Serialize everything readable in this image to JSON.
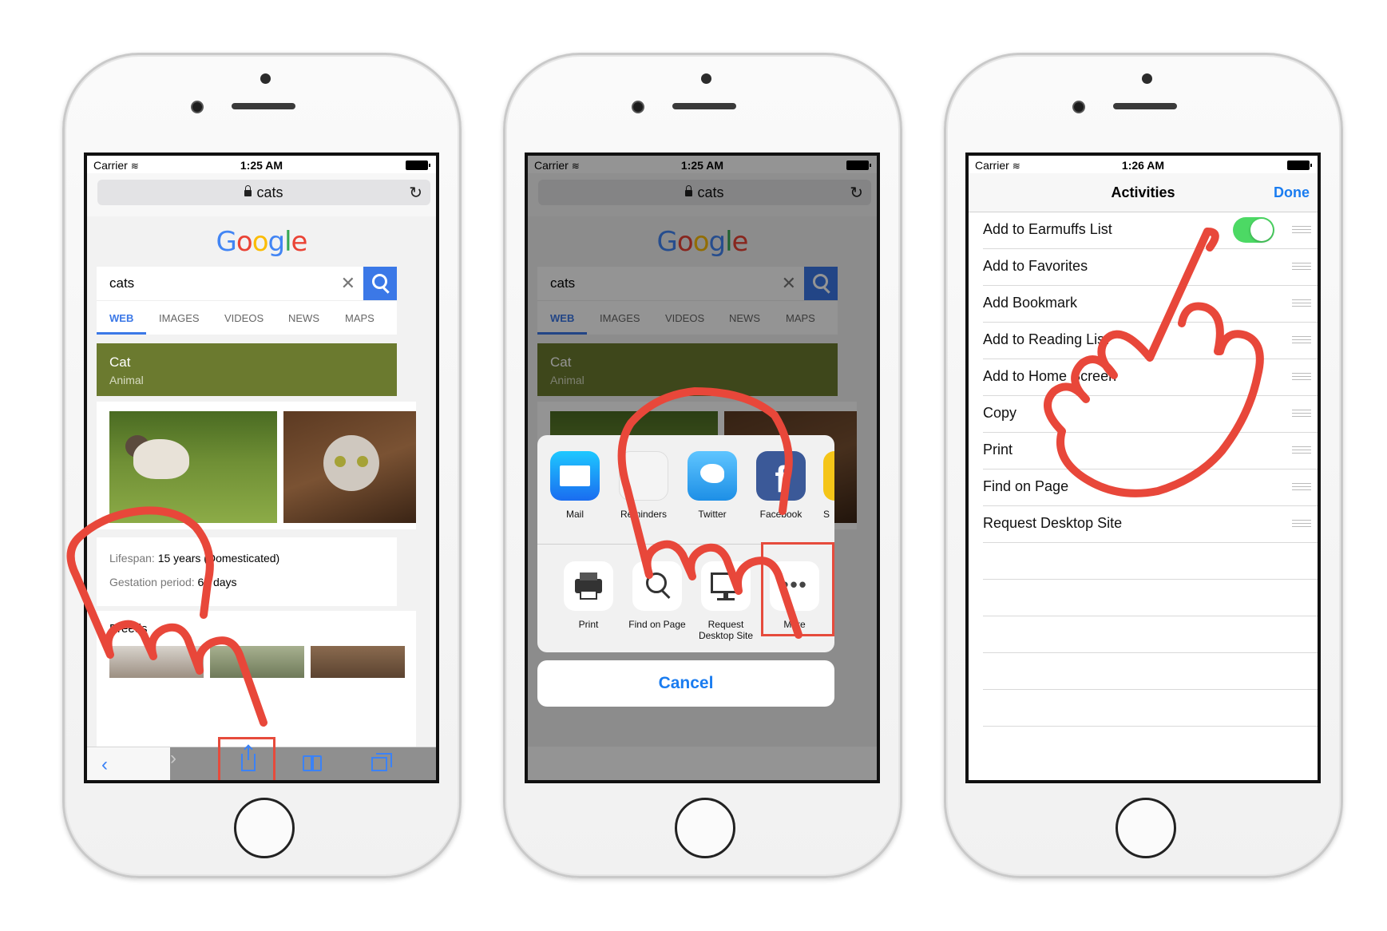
{
  "status": {
    "carrier": "Carrier",
    "time1": "1:25 AM",
    "time2": "1:25 AM",
    "time3": "1:26 AM"
  },
  "safari": {
    "url": "cats"
  },
  "google": {
    "logo": [
      {
        "ch": "G",
        "color": "#4285f4"
      },
      {
        "ch": "o",
        "color": "#ea4335"
      },
      {
        "ch": "o",
        "color": "#fbbc05"
      },
      {
        "ch": "g",
        "color": "#4285f4"
      },
      {
        "ch": "l",
        "color": "#34a853"
      },
      {
        "ch": "e",
        "color": "#ea4335"
      }
    ],
    "query": "cats",
    "tabs": [
      "WEB",
      "IMAGES",
      "VIDEOS",
      "NEWS",
      "MAPS"
    ],
    "card_title": "Cat",
    "card_subtitle": "Animal",
    "lifespan_label": "Lifespan:",
    "lifespan_value": "15 years (Domesticated)",
    "gestation_label": "Gestation period:",
    "gestation_value": "66 days",
    "breeds_heading": "Breeds"
  },
  "share_sheet": {
    "apps": [
      {
        "label": "Mail",
        "icon": "mail-icon",
        "color": "#1e8cf5"
      },
      {
        "label": "Reminders",
        "icon": "reminders-icon",
        "color": "#f4f4f4"
      },
      {
        "label": "Twitter",
        "icon": "twitter-icon",
        "color": "#1da1f2"
      },
      {
        "label": "Facebook",
        "icon": "facebook-icon",
        "color": "#3b5998"
      },
      {
        "label": "S",
        "icon": "partial-app-icon",
        "color": "#f5c518"
      }
    ],
    "actions": [
      {
        "label": "Print",
        "icon": "printer-icon"
      },
      {
        "label": "Find on Page",
        "icon": "magnifier-icon"
      },
      {
        "label": "Request Desktop Site",
        "icon": "monitor-icon"
      },
      {
        "label": "More",
        "icon": "more-dots-icon"
      }
    ],
    "cancel": "Cancel"
  },
  "activities": {
    "title": "Activities",
    "done": "Done",
    "items": [
      {
        "label": "Add to Earmuffs List",
        "toggle_on": true
      },
      {
        "label": "Add to Favorites"
      },
      {
        "label": "Add Bookmark"
      },
      {
        "label": "Add to Reading List"
      },
      {
        "label": "Add to Home Screen"
      },
      {
        "label": "Copy"
      },
      {
        "label": "Print"
      },
      {
        "label": "Find on Page"
      },
      {
        "label": "Request Desktop Site"
      }
    ]
  },
  "colors": {
    "accent": "#1a7cf0",
    "highlight": "#e64b3c",
    "toggle_on": "#4cd964",
    "card_bg": "#6b7a2f"
  }
}
